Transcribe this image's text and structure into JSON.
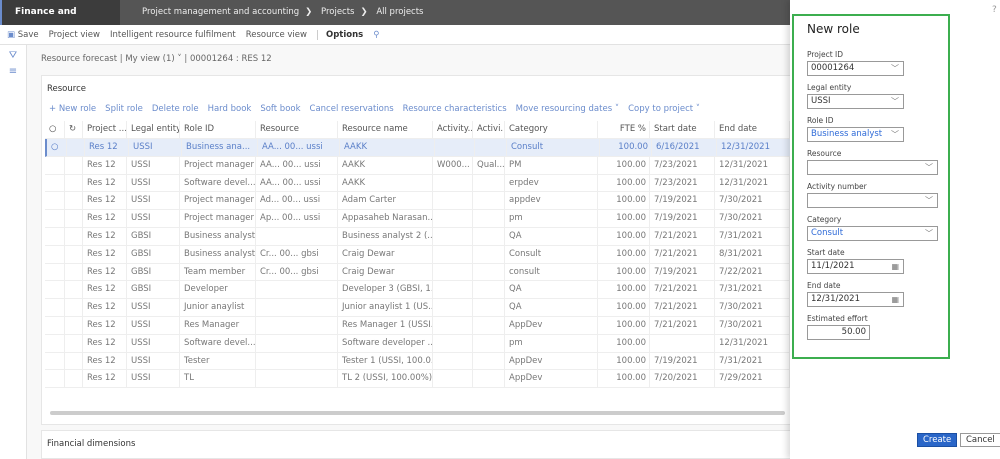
{
  "app": {
    "title": "Finance and Operations",
    "breadcrumb": [
      "Project management and accounting",
      "Projects",
      "All projects"
    ]
  },
  "toolbar": {
    "save": "Save",
    "items": [
      "Project view",
      "Intelligent resource fulfilment",
      "Resource view"
    ],
    "options": "Options"
  },
  "view": {
    "name": "Resource forecast",
    "view": "My view (1)",
    "record": "00001264 : RES 12"
  },
  "resource": {
    "title": "Resource",
    "actions": [
      "+ New role",
      "Split role",
      "Delete role",
      "Hard book",
      "Soft book",
      "Cancel reservations",
      "Resource characteristics",
      "Move resourcing dates ˅",
      "Copy to project ˅"
    ],
    "columns": [
      "",
      "",
      "Project ...",
      "Legal entity",
      "Role ID",
      "Resource",
      "Resource name",
      "Activity...",
      "Activi...",
      "Category",
      "FTE %",
      "Start date",
      "End date"
    ],
    "rows": [
      [
        "Res 12",
        "USSI",
        "Business ana...",
        "AA...  00...  ussi",
        "AAKK",
        "",
        "",
        "Consult",
        "100.00",
        "6/16/2021",
        "12/31/2021"
      ],
      [
        "Res 12",
        "USSI",
        "Project manager",
        "AA...  00...  ussi",
        "AAKK",
        "W000...",
        "Qual...",
        "PM",
        "100.00",
        "7/23/2021",
        "12/31/2021"
      ],
      [
        "Res 12",
        "USSI",
        "Software devel...",
        "AA...  00...  ussi",
        "AAKK",
        "",
        "",
        "erpdev",
        "100.00",
        "7/23/2021",
        "12/31/2021"
      ],
      [
        "Res 12",
        "USSI",
        "Project manager",
        "Ad...  00...  ussi",
        "Adam Carter",
        "",
        "",
        "appdev",
        "100.00",
        "7/19/2021",
        "7/30/2021"
      ],
      [
        "Res 12",
        "USSI",
        "Project manager",
        "Ap...  00...  ussi",
        "Appasaheb Narasan...",
        "",
        "",
        "pm",
        "100.00",
        "7/19/2021",
        "7/30/2021"
      ],
      [
        "Res 12",
        "GBSI",
        "Business analyst",
        "",
        "Business analyst 2 (...",
        "",
        "",
        "QA",
        "100.00",
        "7/21/2021",
        "7/31/2021"
      ],
      [
        "Res 12",
        "GBSI",
        "Business analyst",
        "Cr...  00...  gbsi",
        "Craig Dewar",
        "",
        "",
        "Consult",
        "100.00",
        "7/21/2021",
        "8/31/2021"
      ],
      [
        "Res 12",
        "GBSI",
        "Team member",
        "Cr...  00...  gbsi",
        "Craig Dewar",
        "",
        "",
        "consult",
        "100.00",
        "7/19/2021",
        "7/22/2021"
      ],
      [
        "Res 12",
        "GBSI",
        "Developer",
        "",
        "Developer 3 (GBSI, 1...",
        "",
        "",
        "QA",
        "100.00",
        "7/21/2021",
        "7/31/2021"
      ],
      [
        "Res 12",
        "USSI",
        "Junior anaylist",
        "",
        "Junior anaylist 1 (US...",
        "",
        "",
        "QA",
        "100.00",
        "7/21/2021",
        "7/30/2021"
      ],
      [
        "Res 12",
        "USSI",
        "Res Manager",
        "",
        "Res Manager 1 (USSI...",
        "",
        "",
        "AppDev",
        "100.00",
        "7/21/2021",
        "7/30/2021"
      ],
      [
        "Res 12",
        "USSI",
        "Software devel...",
        "",
        "Software developer ...",
        "",
        "",
        "pm",
        "100.00",
        "",
        "12/31/2021"
      ],
      [
        "Res 12",
        "USSI",
        "Tester",
        "",
        "Tester 1 (USSI, 100.0...",
        "",
        "",
        "AppDev",
        "100.00",
        "7/19/2021",
        "7/31/2021"
      ],
      [
        "Res 12",
        "USSI",
        "TL",
        "",
        "TL 2 (USSI, 100.00%)",
        "",
        "",
        "AppDev",
        "100.00",
        "7/20/2021",
        "7/29/2021"
      ]
    ]
  },
  "financial": {
    "title": "Financial dimensions"
  },
  "new_role": {
    "title": "New role",
    "help": "?",
    "project_id": {
      "label": "Project ID",
      "value": "00001264"
    },
    "legal_entity": {
      "label": "Legal entity",
      "value": "USSI"
    },
    "role_id": {
      "label": "Role ID",
      "value": "Business analyst"
    },
    "resource": {
      "label": "Resource",
      "value": ""
    },
    "activity": {
      "label": "Activity number",
      "value": ""
    },
    "category": {
      "label": "Category",
      "value": "Consult"
    },
    "start": {
      "label": "Start date",
      "value": "11/1/2021"
    },
    "end": {
      "label": "End date",
      "value": "12/31/2021"
    },
    "effort": {
      "label": "Estimated effort",
      "value": "50.00"
    },
    "create": "Create",
    "cancel": "Cancel"
  },
  "colors": {
    "accent": "#2a66c8",
    "highlight": "#3cae4f"
  }
}
